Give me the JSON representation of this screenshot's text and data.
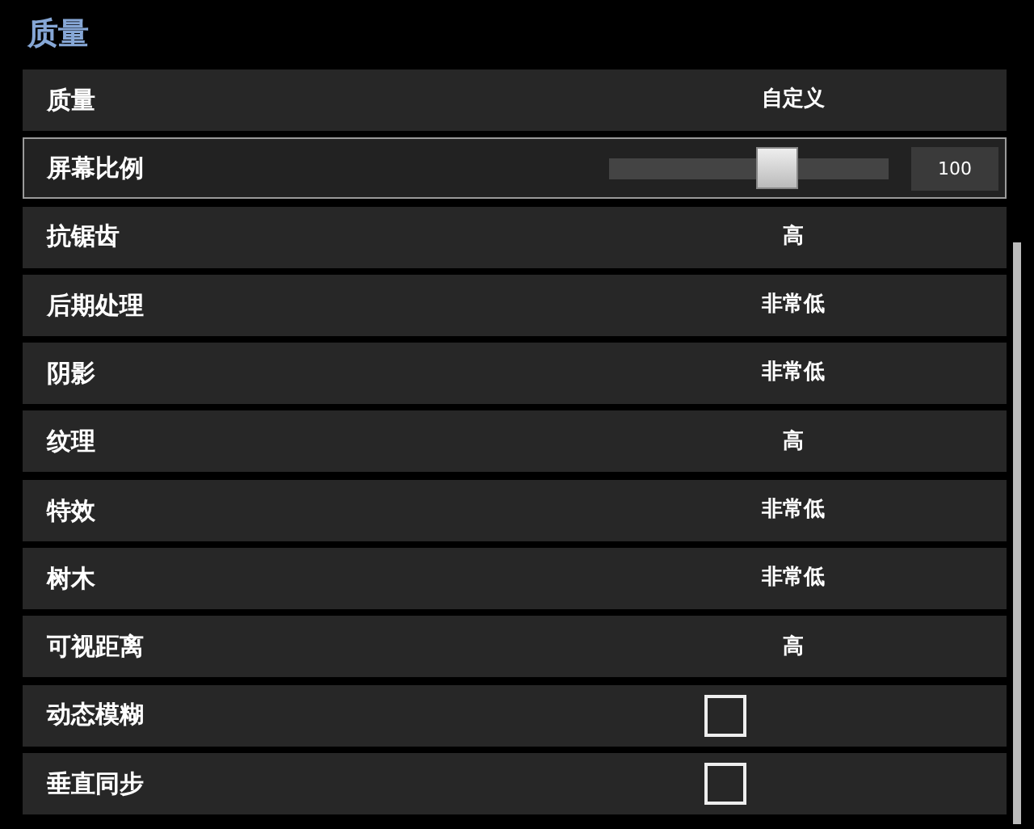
{
  "section_title": "质量",
  "settings": [
    {
      "kind": "select",
      "label": "质量",
      "value": "自定义",
      "selected": false
    },
    {
      "kind": "slider",
      "label": "屏幕比例",
      "level": 0.6,
      "reading": "100",
      "selected": true
    },
    {
      "kind": "select",
      "label": "抗锯齿",
      "value": "高",
      "selected": false
    },
    {
      "kind": "select",
      "label": "后期处理",
      "value": "非常低",
      "selected": false
    },
    {
      "kind": "select",
      "label": "阴影",
      "value": "非常低",
      "selected": false
    },
    {
      "kind": "select",
      "label": "纹理",
      "value": "高",
      "selected": false
    },
    {
      "kind": "select",
      "label": "特效",
      "value": "非常低",
      "selected": false
    },
    {
      "kind": "select",
      "label": "树木",
      "value": "非常低",
      "selected": false
    },
    {
      "kind": "select",
      "label": "可视距离",
      "value": "高",
      "selected": false
    },
    {
      "kind": "checkbox",
      "label": "动态模糊",
      "checked": false,
      "selected": false
    },
    {
      "kind": "checkbox",
      "label": "垂直同步",
      "checked": false,
      "selected": false
    }
  ]
}
